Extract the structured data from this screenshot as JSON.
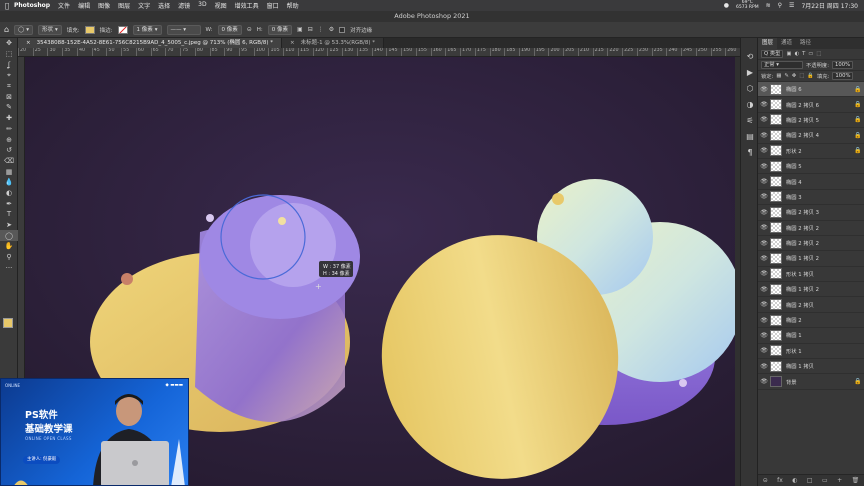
{
  "menubar": {
    "app": "Photoshop",
    "items": [
      "文件",
      "编辑",
      "图像",
      "图层",
      "文字",
      "选择",
      "滤镜",
      "3D",
      "视图",
      "增效工具",
      "窗口",
      "帮助"
    ],
    "weather_temp": "69°C",
    "weather_rpm": "6573 RPM",
    "clock": "7月22日 周四  17:30"
  },
  "window": {
    "title": "Adobe Photoshop 2021"
  },
  "options": {
    "shape_mode": "形状",
    "fill_label": "填充:",
    "fill_color": "#e8c96a",
    "stroke_label": "描边:",
    "stroke_width": "1 像素",
    "w_label": "W:",
    "w_value": "0 像素",
    "h_label": "H:",
    "h_value": "0 像素",
    "align_edges": "对齐边缘"
  },
  "tabs": [
    {
      "label": "35438088-152E-4A52-8E61-756C8215B9AD_4_5005_c.jpeg @ 713% (椭圆 6, RGB/8) *",
      "close": "×",
      "active": true
    },
    {
      "label": "未标题-1 @ 53.3%(RGB/8) *",
      "close": "×",
      "active": false
    }
  ],
  "ruler_ticks": [
    "20",
    "25",
    "30",
    "35",
    "40",
    "45",
    "50",
    "55",
    "60",
    "65",
    "70",
    "75",
    "80",
    "85",
    "90",
    "95",
    "100",
    "105",
    "110",
    "115",
    "120",
    "125",
    "130",
    "135",
    "140",
    "145",
    "150",
    "155",
    "160",
    "165",
    "170",
    "175",
    "180",
    "185",
    "190",
    "195",
    "200",
    "205",
    "210",
    "215",
    "220",
    "225",
    "230",
    "235",
    "240",
    "245",
    "250",
    "255",
    "260"
  ],
  "canvas": {
    "tooltip_w": "W : 37 像素",
    "tooltip_h": "H : 34 像素",
    "colors": {
      "bg": "#2b2036",
      "yellow": "#e8c96a",
      "purple": "#8d6fd6",
      "mint": "#cfe8cf"
    }
  },
  "tools": [
    "move-icon",
    "marquee-icon",
    "lasso-icon",
    "quick-select-icon",
    "crop-icon",
    "frame-icon",
    "eyedropper-icon",
    "healing-icon",
    "brush-icon",
    "stamp-icon",
    "history-brush-icon",
    "eraser-icon",
    "gradient-icon",
    "blur-icon",
    "dodge-icon",
    "pen-icon",
    "type-icon",
    "path-select-icon",
    "ellipse-icon",
    "hand-icon",
    "zoom-icon",
    "more-icon"
  ],
  "tool_glyphs": [
    "✥",
    "⬚",
    "ʆ",
    "⌖",
    "⌗",
    "⊠",
    "✎",
    "✚",
    "✏",
    "⊕",
    "↺",
    "⌫",
    "▦",
    "💧",
    "◐",
    "✒",
    "T",
    "➤",
    "◯",
    "✋",
    "⚲",
    "···"
  ],
  "layers_panel": {
    "tabs": [
      "图层",
      "通道",
      "路径"
    ],
    "kind_filter": "Q 类型",
    "blend_mode": "正常",
    "opacity_label": "不透明度:",
    "opacity_value": "100%",
    "lock_label": "锁定:",
    "fill_label": "填充:",
    "fill_value": "100%",
    "layers": [
      {
        "name": "椭圆 6",
        "selected": true,
        "locked": true
      },
      {
        "name": "椭圆 2 拷贝 6",
        "selected": false,
        "locked": true
      },
      {
        "name": "椭圆 2 拷贝 5",
        "selected": false,
        "locked": true
      },
      {
        "name": "椭圆 2 拷贝 4",
        "selected": false,
        "locked": true
      },
      {
        "name": "形状 2",
        "selected": false,
        "locked": true
      },
      {
        "name": "椭圆 5",
        "selected": false,
        "locked": false
      },
      {
        "name": "椭圆 4",
        "selected": false,
        "locked": false
      },
      {
        "name": "椭圆 3",
        "selected": false,
        "locked": false
      },
      {
        "name": "椭圆 2 拷贝 3",
        "selected": false,
        "locked": false
      },
      {
        "name": "椭圆 2 拷贝 2",
        "selected": false,
        "locked": false
      },
      {
        "name": "椭圆 2 拷贝 2",
        "selected": false,
        "locked": false
      },
      {
        "name": "椭圆 1 拷贝 2",
        "selected": false,
        "locked": false
      },
      {
        "name": "形状 1 拷贝",
        "selected": false,
        "locked": false
      },
      {
        "name": "椭圆 1 拷贝 2",
        "selected": false,
        "locked": false
      },
      {
        "name": "椭圆 2 拷贝",
        "selected": false,
        "locked": false
      },
      {
        "name": "椭圆 2",
        "selected": false,
        "locked": false
      },
      {
        "name": "椭圆 1",
        "selected": false,
        "locked": false
      },
      {
        "name": "形状 1",
        "selected": false,
        "locked": false
      },
      {
        "name": "椭圆 1 拷贝",
        "selected": false,
        "locked": false
      },
      {
        "name": "背景",
        "selected": false,
        "locked": true,
        "background": true
      }
    ],
    "footer": [
      "fx",
      "◐",
      "□",
      "▭",
      "+",
      "🗑"
    ]
  },
  "webcam": {
    "title1": "PS软件",
    "title2": "基础教学课",
    "subtitle": "ONLINE OPEN CLASS",
    "lecturer": "主讲人: 倪豪毅"
  }
}
